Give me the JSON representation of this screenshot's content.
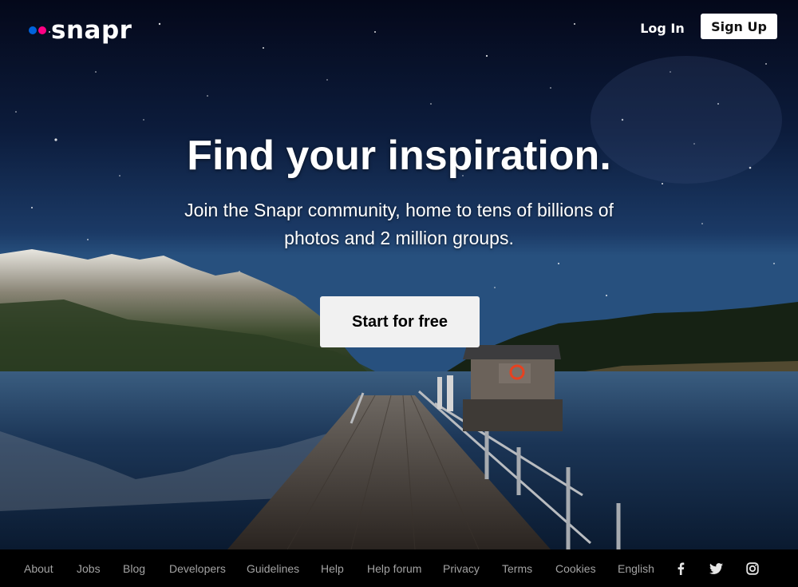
{
  "brand": {
    "name": "snapr",
    "dot_colors": [
      "#0063dc",
      "#ff0084"
    ]
  },
  "header": {
    "login_label": "Log In",
    "signup_label": "Sign Up"
  },
  "hero": {
    "headline": "Find your inspiration.",
    "subline": "Join the Snapr community, home to tens of billions of photos and 2 million groups.",
    "cta_label": "Start for free"
  },
  "footer": {
    "links": [
      "About",
      "Jobs",
      "Blog",
      "Developers",
      "Guidelines",
      "Help",
      "Help forum",
      "Privacy",
      "Terms",
      "Cookies",
      "English"
    ],
    "social_icons": [
      "facebook-icon",
      "twitter-icon",
      "instagram-icon"
    ]
  },
  "colors": {
    "footer_link": "#a3a3a3",
    "cta_bg": "#f1f1f1",
    "signup_bg": "#ffffff"
  }
}
